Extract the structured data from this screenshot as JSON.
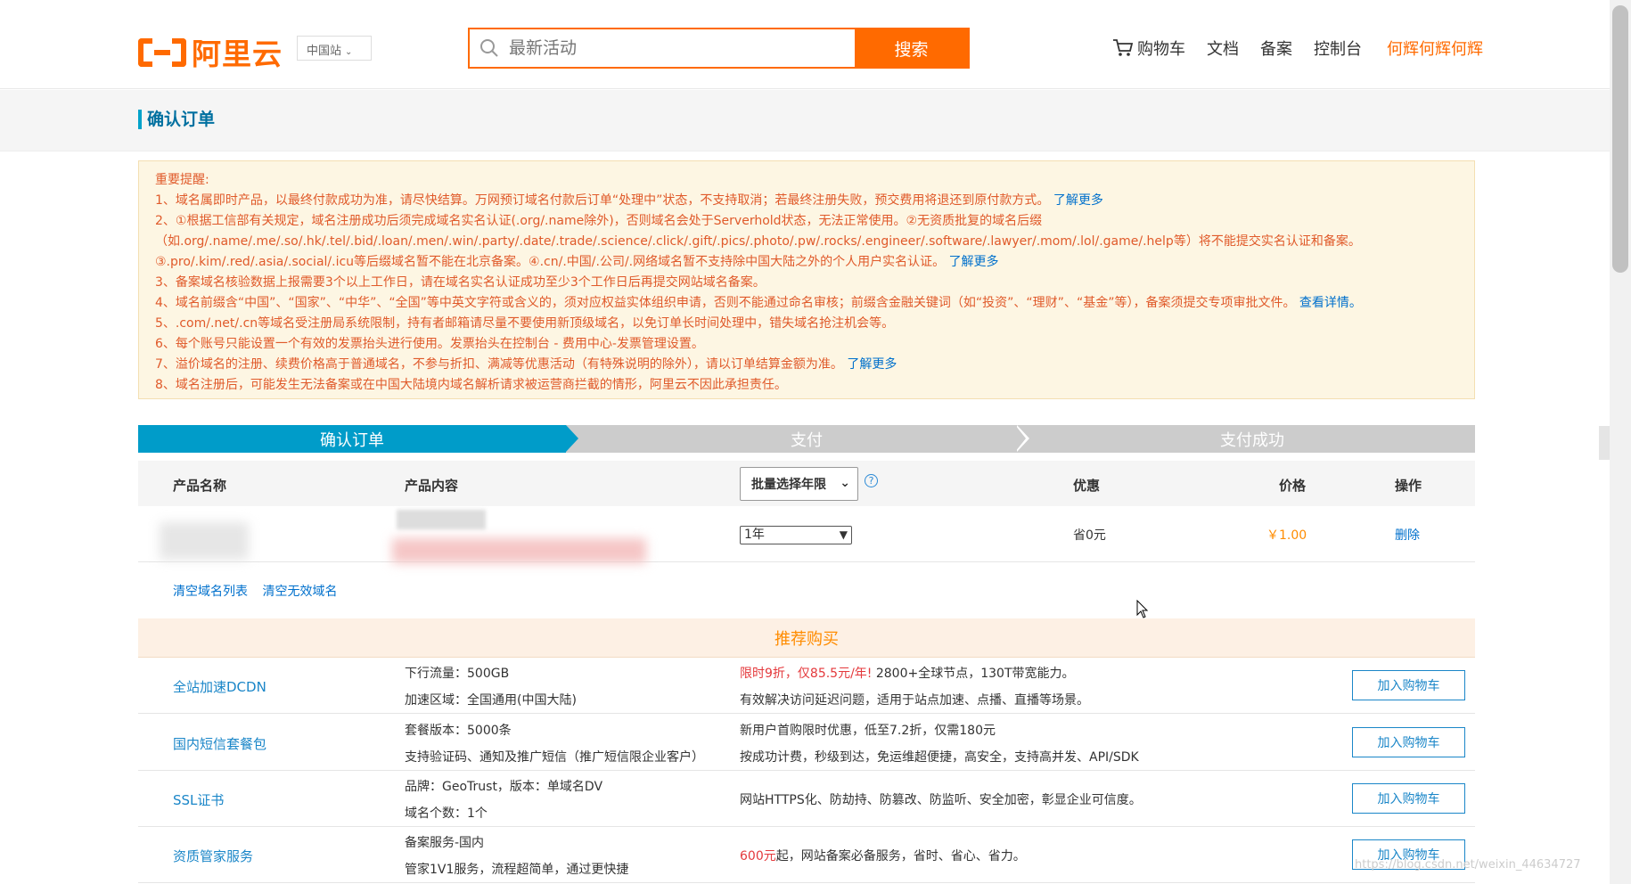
{
  "header": {
    "logo_text": "阿里云",
    "site_selector": "中国站",
    "search_placeholder": "最新活动",
    "search_button": "搜索",
    "nav": {
      "cart": "购物车",
      "docs": "文档",
      "beian": "备案",
      "console": "控制台",
      "user": "何辉何辉何辉"
    }
  },
  "page_title": "确认订单",
  "notice": {
    "title": "重要提醒:",
    "lines": [
      "1、域名属即时产品，以最终付款成功为准，请尽快结算。万网预订域名付款后订单“处理中”状态，不支持取消；若最终注册失败，预交费用将退还到原付款方式。",
      "2、①根据工信部有关规定，域名注册成功后须完成域名实名认证(.org/.name除外)，否则域名会处于Serverhold状态，无法正常使用。②无资质批复的域名后缀（如.org/.name/.me/.so/.hk/.tel/.bid/.loan/.men/.win/.party/.date/.trade/.science/.click/.gift/.pics/.photo/.pw/.rocks/.engineer/.software/.lawyer/.mom/.lol/.game/.help等）将不能提交实名认证和备案。③.pro/.kim/.red/.asia/.social/.icu等后缀域名暂不能在北京备案。④.cn/.中国/.公司/.网络域名暂不支持除中国大陆之外的个人用户实名认证。",
      "3、备案域名核验数据上报需要3个以上工作日，请在域名实名认证成功至少3个工作日后再提交网站域名备案。",
      "4、域名前缀含“中国”、“国家”、“中华”、“全国”等中英文字符或含义的，须对应权益实体组织申请，否则不能通过命名审核；前缀含金融关键词（如“投资”、“理财”、“基金”等），备案须提交专项审批文件。",
      "5、.com/.net/.cn等域名受注册局系统限制，持有者邮箱请尽量不要使用新顶级域名，以免订单长时间处理中，错失域名抢注机会等。",
      "6、每个账号只能设置一个有效的发票抬头进行使用。发票抬头在控制台 - 费用中心-发票管理设置。",
      "7、溢价域名的注册、续费价格高于普通域名，不参与折扣、满减等优惠活动（有特殊说明的除外），请以订单结算金额为准。",
      "8、域名注册后，可能发生无法备案或在中国大陆境内域名解析请求被运营商拦截的情形，阿里云不因此承担责任。"
    ],
    "link_more": "了解更多",
    "link_detail": "查看详情。"
  },
  "steps": [
    "确认订单",
    "支付",
    "支付成功"
  ],
  "table": {
    "headers": {
      "product_name": "产品名称",
      "product_content": "产品内容",
      "batch_select": "批量选择年限",
      "discount": "优惠",
      "price": "价格",
      "action": "操作"
    },
    "row": {
      "year": "1年",
      "discount": "省0元",
      "price": "￥1.00",
      "action": "删除"
    }
  },
  "clear_links": [
    "清空域名列表",
    "清空无效域名"
  ],
  "recommend": {
    "title": "推荐购买",
    "add_label": "加入购物车",
    "items": [
      {
        "name": "全站加速DCDN",
        "d1": "下行流量：500GB",
        "d2": "加速区域：全国通用(中国大陆)",
        "i1_red": "限时9折，仅85.5元/年!",
        "i1": " 2800+全球节点，130T带宽能力。",
        "i2": "有效解决访问延迟问题，适用于站点加速、点播、直播等场景。"
      },
      {
        "name": "国内短信套餐包",
        "d1": "套餐版本：5000条",
        "d2": "支持验证码、通知及推广短信（推广短信限企业客户）",
        "i1_red": "",
        "i1": "新用户首购限时优惠，低至7.2折，仅需180元",
        "i2": "按成功计费，秒级到达，免运维超便捷，高安全，支持高并发、API/SDK"
      },
      {
        "name": "SSL证书",
        "d1": "品牌：GeoTrust，版本：单域名DV",
        "d2": "域名个数：1个",
        "single": "网站HTTPS化、防劫持、防篡改、防监听、安全加密，彰显企业可信度。"
      },
      {
        "name": "资质管家服务",
        "d1": "备案服务-国内",
        "d2": "管家1V1服务，流程超简单，通过更快捷",
        "single_red": "600元",
        "single": "起，网站备案必备服务，省时、省心、省力。"
      }
    ]
  },
  "watermark": "https://blog.csdn.net/weixin_44634727",
  "colors": {
    "brand": "#ff6a00",
    "step_active": "#009cc9",
    "link": "#1a86c8",
    "notice_text": "#e05a2a",
    "price": "#ff8c00"
  }
}
